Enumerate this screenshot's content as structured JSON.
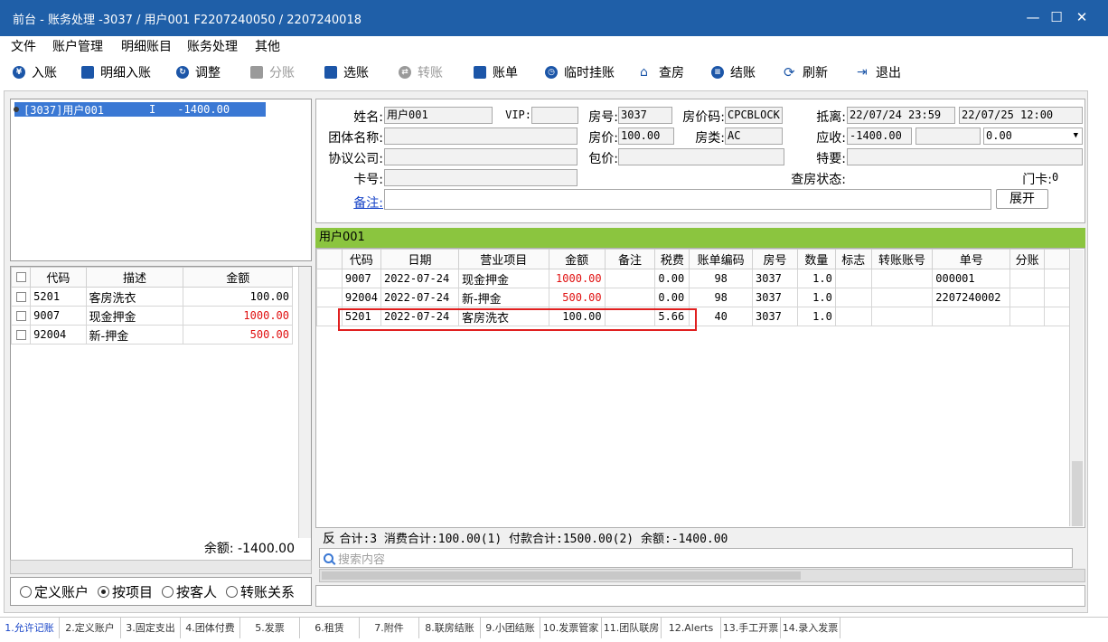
{
  "window": {
    "title": "前台 - 账务处理 -3037 / 用户001  F2207240050 / 2207240018",
    "minimize": "—",
    "maximize": "☐",
    "close": "✕"
  },
  "menu": [
    "文件",
    "账户管理",
    "明细账目",
    "账务处理",
    "其他"
  ],
  "toolbar": [
    {
      "label": "入账",
      "icon": "yen-circle-icon",
      "enabled": true
    },
    {
      "label": "明细入账",
      "icon": "card-icon",
      "enabled": true
    },
    {
      "label": "调整",
      "icon": "adjust-icon",
      "enabled": true
    },
    {
      "label": "分账",
      "icon": "split-icon",
      "enabled": false
    },
    {
      "label": "选账",
      "icon": "select-icon",
      "enabled": true
    },
    {
      "label": "转账",
      "icon": "transfer-icon",
      "enabled": false
    },
    {
      "label": "账单",
      "icon": "bill-icon",
      "enabled": true
    },
    {
      "label": "临时挂账",
      "icon": "clock-icon",
      "enabled": true
    },
    {
      "label": "查房",
      "icon": "house-icon",
      "enabled": true
    },
    {
      "label": "结账",
      "icon": "coins-icon",
      "enabled": true
    },
    {
      "label": "刷新",
      "icon": "refresh-icon",
      "enabled": true
    },
    {
      "label": "退出",
      "icon": "exit-icon",
      "enabled": true
    }
  ],
  "tree": {
    "node": "[3037]用户001",
    "flag": "I",
    "amount": "-1400.00"
  },
  "left_grid": {
    "headers": [
      "代码",
      "描述",
      "金额"
    ],
    "rows": [
      {
        "code": "5201",
        "desc": "客房洗衣",
        "amount": "100.00",
        "red": false
      },
      {
        "code": "9007",
        "desc": "现金押金",
        "amount": "1000.00",
        "red": true
      },
      {
        "code": "92004",
        "desc": "新-押金",
        "amount": "500.00",
        "red": true
      }
    ],
    "balance": "余额: -1400.00"
  },
  "account_modes": [
    {
      "label": "定义账户",
      "selected": false
    },
    {
      "label": "按项目",
      "selected": true
    },
    {
      "label": "按客人",
      "selected": false
    },
    {
      "label": "转账关系",
      "selected": false
    }
  ],
  "guest": {
    "name_label": "姓名:",
    "name": "用户001",
    "vip_label": "VIP:",
    "vip": "",
    "room_label": "房号:",
    "room": "3037",
    "rate_code_label": "房价码:",
    "rate_code": "CPCBLOCK",
    "arrive_label": "抵离:",
    "arrive": "22/07/24 23:59",
    "depart": "22/07/25 12:00",
    "group_label": "团体名称:",
    "group": "",
    "price_label": "房价:",
    "price": "100.00",
    "room_type_label": "房类:",
    "room_type": "AC",
    "receivable_label": "应收:",
    "receivable": "-1400.00",
    "receivable2": "",
    "receivable3": "0.00",
    "company_label": "协议公司:",
    "company": "",
    "package_label": "包价:",
    "package": "",
    "special_label": "特要:",
    "special": "",
    "card_label": "卡号:",
    "card": "",
    "check_status_label": "查房状态:",
    "door_card_label": "门卡:",
    "door_card": "0",
    "remark_label": "备注:",
    "remark": "",
    "expand_button": "展开"
  },
  "detail": {
    "group_title": "用户001",
    "headers": [
      "代码",
      "日期",
      "营业项目",
      "金额",
      "备注",
      "税费",
      "账单编码",
      "房号",
      "数量",
      "标志",
      "转账账号",
      "单号",
      "分账"
    ],
    "rows": [
      {
        "code": "9007",
        "date": "2022-07-24",
        "item": "现金押金",
        "amount": "1000.00",
        "red": true,
        "note": "",
        "tax": "0.00",
        "bill": "98",
        "room": "3037",
        "qty": "1.0",
        "flag": "",
        "transfer": "",
        "no": "000001",
        "split": ""
      },
      {
        "code": "92004",
        "date": "2022-07-24",
        "item": "新-押金",
        "amount": "500.00",
        "red": true,
        "note": "",
        "tax": "0.00",
        "bill": "98",
        "room": "3037",
        "qty": "1.0",
        "flag": "",
        "transfer": "",
        "no": "2207240002",
        "split": ""
      },
      {
        "code": "5201",
        "date": "2022-07-24",
        "item": "客房洗衣",
        "amount": "100.00",
        "red": false,
        "note": "",
        "tax": "5.66",
        "bill": "40",
        "room": "3037",
        "qty": "1.0",
        "flag": "",
        "transfer": "",
        "no": "",
        "split": ""
      }
    ],
    "summary_prefix": "反",
    "summary": "合计:3  消费合计:100.00(1)  付款合计:1500.00(2)  余额:-1400.00",
    "search_placeholder": "搜索内容"
  },
  "tabs": [
    {
      "label": "1.允许记账",
      "active": true
    },
    {
      "label": "2.定义账户",
      "active": false
    },
    {
      "label": "3.固定支出",
      "active": false
    },
    {
      "label": "4.团体付费",
      "active": false
    },
    {
      "label": "5.发票",
      "active": false
    },
    {
      "label": "6.租赁",
      "active": false
    },
    {
      "label": "7.附件",
      "active": false
    },
    {
      "label": "8.联房结账",
      "active": false
    },
    {
      "label": "9.小团结账",
      "active": false
    },
    {
      "label": "10.发票管家",
      "active": false
    },
    {
      "label": "11.团队联房",
      "active": false
    },
    {
      "label": "12.Alerts",
      "active": false
    },
    {
      "label": "13.手工开票",
      "active": false
    },
    {
      "label": "14.录入发票",
      "active": false
    }
  ]
}
